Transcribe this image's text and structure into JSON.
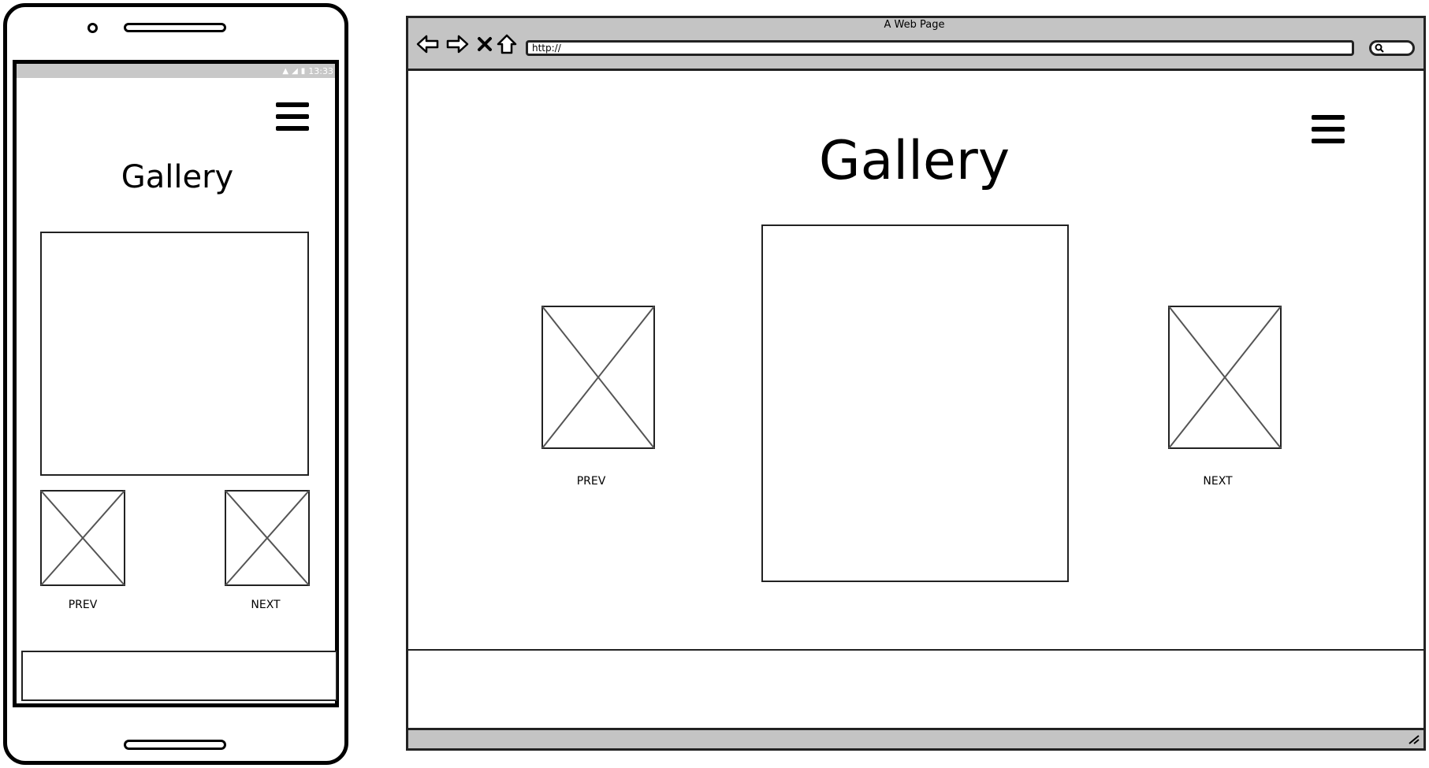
{
  "phone": {
    "status_time": "13:33",
    "page_title": "Gallery",
    "prev_label": "PREV",
    "next_label": "NEXT"
  },
  "browser": {
    "window_title": "A Web Page",
    "url": "http://",
    "page_title": "Gallery",
    "prev_label": "PREV",
    "next_label": "NEXT"
  },
  "icons": {
    "back": "arrow-left-icon",
    "forward": "arrow-right-icon",
    "stop": "close-icon",
    "home": "home-icon",
    "search": "search-icon",
    "menu": "hamburger-menu-icon",
    "placeholder": "image-placeholder-icon",
    "wifi": "wifi-icon",
    "signal": "signal-icon",
    "battery": "battery-icon"
  },
  "colors": {
    "chrome_gray": "#c4c4c4",
    "status_gray": "#c8c8c8",
    "stroke": "#222222"
  }
}
